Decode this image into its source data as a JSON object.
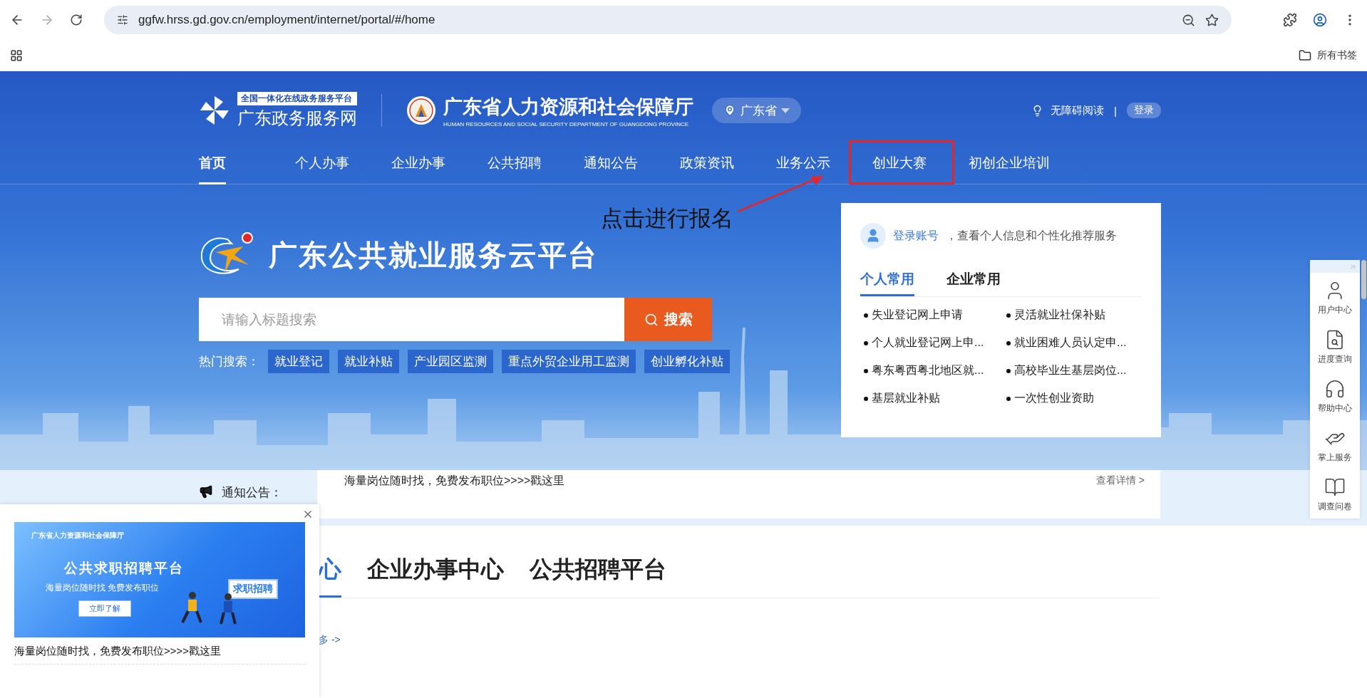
{
  "browser": {
    "url": "ggfw.hrss.gd.gov.cn/employment/internet/portal/#/home",
    "bookmarks_label": "所有书签"
  },
  "header": {
    "gov_logo": {
      "tagline": "全国一体化在线政务服务平台",
      "name": "广东政务服务网"
    },
    "dept_logo": {
      "name": "广东省人力资源和社会保障厅",
      "english": "HUMAN RESOURCES AND SOCIAL SECURITY DEPARTMENT OF GUANGDONG PROVINCE"
    },
    "region": "广东省",
    "accessibility": "无障碍阅读",
    "separator": "|",
    "login": "登录"
  },
  "nav": [
    {
      "label": "首页",
      "selected": true,
      "annotated": false
    },
    {
      "label": "个人办事",
      "selected": false,
      "annotated": false
    },
    {
      "label": "企业办事",
      "selected": false,
      "annotated": false
    },
    {
      "label": "公共招聘",
      "selected": false,
      "annotated": false
    },
    {
      "label": "通知公告",
      "selected": false,
      "annotated": false
    },
    {
      "label": "政策资讯",
      "selected": false,
      "annotated": false
    },
    {
      "label": "业务公示",
      "selected": false,
      "annotated": false
    },
    {
      "label": "创业大赛",
      "selected": false,
      "annotated": true
    },
    {
      "label": "初创企业培训",
      "selected": false,
      "annotated": false
    }
  ],
  "annotation": {
    "text": "点击进行报名"
  },
  "hero": {
    "title": "广东公共就业服务云平台",
    "search": {
      "placeholder": "请输入标题搜索",
      "button": "搜索"
    },
    "hot_label": "热门搜索：",
    "hot_tags": [
      "就业登记",
      "就业补贴",
      "产业园区监测",
      "重点外贸企业用工监测",
      "创业孵化补贴"
    ]
  },
  "service_panel": {
    "login_link": "登录账号",
    "login_hint": "，查看个人信息和个性化推荐服务",
    "tabs": [
      {
        "label": "个人常用",
        "selected": true
      },
      {
        "label": "企业常用",
        "selected": false
      }
    ],
    "items": [
      "失业登记网上申请",
      "灵活就业社保补贴",
      "个人就业登记网上申...",
      "就业困难人员认定申...",
      "粤东粤西粤北地区就...",
      "高校毕业生基层岗位...",
      "基层就业补贴",
      "一次性创业资助"
    ]
  },
  "notice": {
    "label": "通知公告：",
    "items": [
      {
        "title": "海量岗位随时找，免费发布职位>>>>戳这里",
        "link": "查看详情 >"
      }
    ]
  },
  "center_tabs": [
    {
      "label": "心",
      "selected": true
    },
    {
      "label": "企业办事中心",
      "selected": false
    },
    {
      "label": "公共招聘平台",
      "selected": false
    }
  ],
  "more_link": "多 ->",
  "popup": {
    "banner": {
      "org": "广东省人力资源和社会保障厅",
      "title": "公共求职招聘平台",
      "subtitle": "海量岗位随时找 免费发布职位",
      "button": "立即了解",
      "sign": "求职招聘"
    },
    "caption": "海量岗位随时找，免费发布职位>>>>戳这里"
  },
  "side_bar": [
    {
      "label": "用户中心",
      "kind": "user"
    },
    {
      "label": "进度查询",
      "kind": "progress"
    },
    {
      "label": "帮助中心",
      "kind": "help"
    },
    {
      "label": "掌上服务",
      "kind": "mobile"
    },
    {
      "label": "调查问卷",
      "kind": "survey"
    }
  ]
}
